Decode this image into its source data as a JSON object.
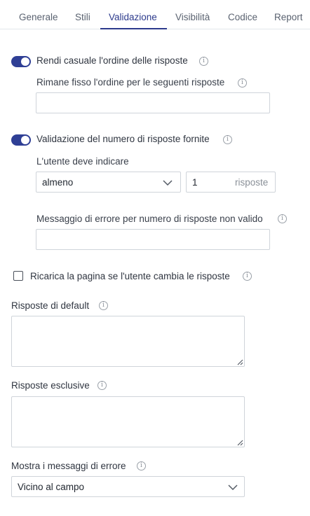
{
  "tabs": [
    {
      "label": "Generale"
    },
    {
      "label": "Stili"
    },
    {
      "label": "Validazione",
      "active": true
    },
    {
      "label": "Visibilità"
    },
    {
      "label": "Codice"
    },
    {
      "label": "Report"
    }
  ],
  "random_order": {
    "label": "Rendi casuale l'ordine delle risposte",
    "enabled": true,
    "fixed_label": "Rimane fisso l'ordine per le seguenti risposte",
    "fixed_value": ""
  },
  "count_validation": {
    "label": "Validazione del numero di risposte fornite",
    "enabled": true,
    "user_must_label": "L'utente deve indicare",
    "operator_value": "almeno",
    "count_value": "1",
    "count_suffix": "risposte",
    "error_label": "Messaggio di errore per numero di risposte non valido",
    "error_value": ""
  },
  "reload": {
    "label": "Ricarica la pagina se l'utente cambia le risposte",
    "checked": false
  },
  "default_answers": {
    "label": "Risposte di default",
    "value": ""
  },
  "exclusive_answers": {
    "label": "Risposte esclusive",
    "value": ""
  },
  "error_messages": {
    "label": "Mostra i messaggi di errore",
    "value": "Vicino al campo"
  },
  "colors": {
    "accent": "#2f3f95",
    "tab_active": "#2c3a8c",
    "border": "#cfd4da"
  }
}
